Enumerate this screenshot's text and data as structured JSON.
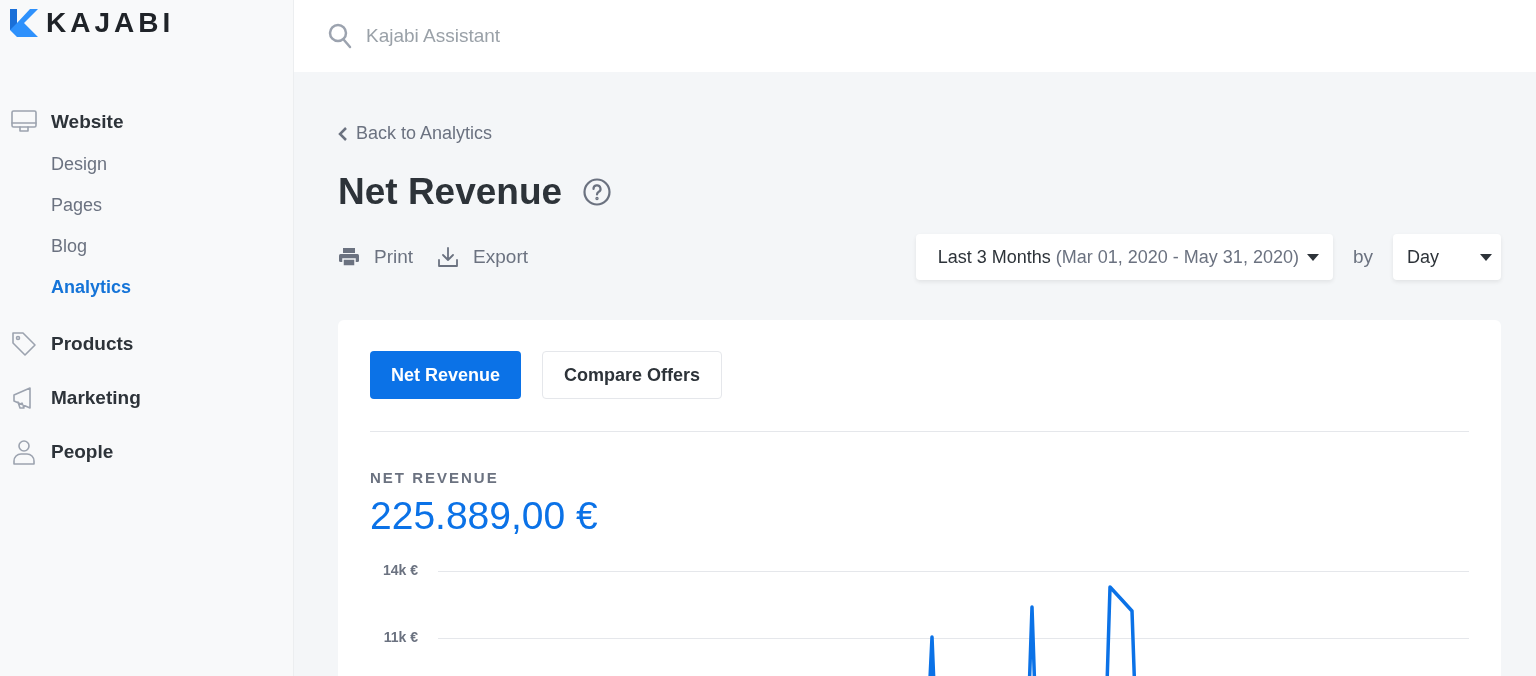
{
  "logo": {
    "text": "KAJABI"
  },
  "search": {
    "placeholder": "Kajabi Assistant"
  },
  "sidebar": {
    "items": [
      {
        "label": "Website",
        "children": [
          {
            "label": "Design",
            "selected": false
          },
          {
            "label": "Pages",
            "selected": false
          },
          {
            "label": "Blog",
            "selected": false
          },
          {
            "label": "Analytics",
            "selected": true
          }
        ]
      },
      {
        "label": "Products"
      },
      {
        "label": "Marketing"
      },
      {
        "label": "People"
      }
    ]
  },
  "back_link": "Back to Analytics",
  "title": "Net Revenue",
  "actions": [
    {
      "label": "Print",
      "kind": "print"
    },
    {
      "label": "Export",
      "kind": "export"
    }
  ],
  "date_range": {
    "value": "Last 3 Months",
    "detail": "(Mar 01, 2020 - May 31, 2020)"
  },
  "by_label": "by",
  "interval": {
    "value": "Day"
  },
  "tabs": [
    {
      "label": "Net Revenue",
      "selected": true
    },
    {
      "label": "Compare Offers",
      "selected": false
    }
  ],
  "metric": {
    "label": "NET REVENUE",
    "value": "225.889,00 €"
  },
  "chart": {
    "y_labels": [
      "14k €",
      "11k €"
    ]
  }
}
